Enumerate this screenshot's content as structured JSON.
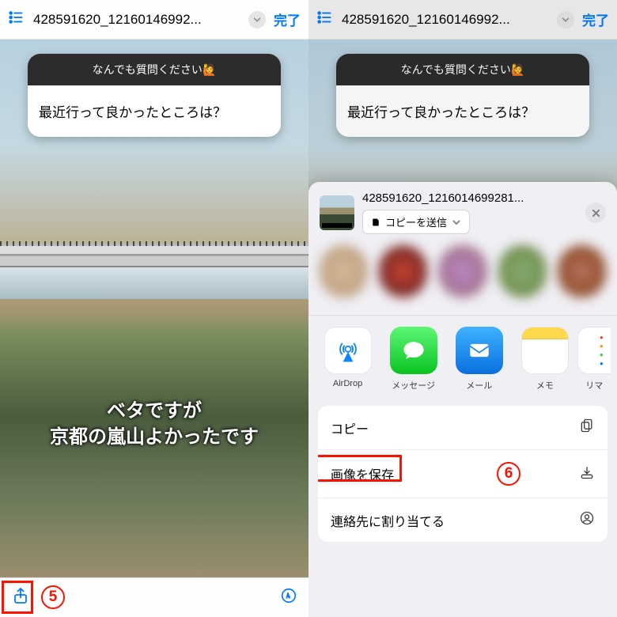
{
  "nav": {
    "title": "428591620_12160146992...",
    "done": "完了"
  },
  "qa": {
    "head": "なんでも質問ください",
    "emoji": "🙋",
    "body": "最近行って良かったところは？"
  },
  "caption": {
    "line1": "ベタですが",
    "line2": "京都の嵐山よかったです"
  },
  "annotations": {
    "step5": "5",
    "step6": "6"
  },
  "sheet": {
    "filename": "428591620_1216014699281...",
    "copy_send": "コピーを送信",
    "apps": {
      "airdrop": "AirDrop",
      "messages": "メッセージ",
      "mail": "メール",
      "memo": "メモ",
      "reminder": "リマ"
    },
    "actions": {
      "copy": "コピー",
      "save_image": "画像を保存",
      "assign_contact": "連絡先に割り当てる"
    }
  }
}
